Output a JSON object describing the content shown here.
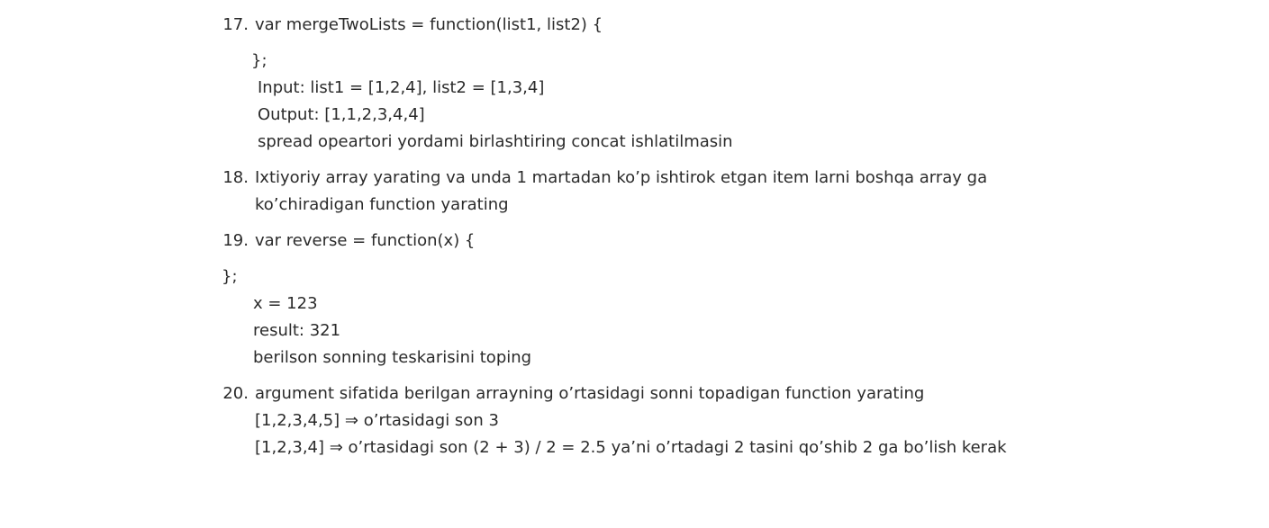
{
  "items": [
    {
      "number": "17.",
      "lines": [
        "var mergeTwoLists = function(list1, list2) {",
        "};",
        "Input: list1 = [1,2,4], list2 = [1,3,4]",
        "Output: [1,1,2,3,4,4]",
        "spread opeartori yordami birlashtiring concat ishlatilmasin"
      ]
    },
    {
      "number": "18.",
      "lines": [
        "Ixtiyoriy array yarating va unda 1 martadan ko’p ishtirok etgan item larni boshqa array ga",
        "ko’chiradigan function yarating"
      ]
    },
    {
      "number": "19.",
      "lines": [
        "var reverse = function(x) {",
        "};",
        "x = 123",
        "result: 321",
        "berilson sonning teskarisini toping"
      ]
    },
    {
      "number": "20.",
      "lines": [
        "argument sifatida berilgan arrayning o’rtasidagi sonni topadigan function yarating",
        "[1,2,3,4,5] ⇒ o’rtasidagi son 3",
        "[1,2,3,4] ⇒ o’rtasidagi son (2 + 3) / 2 = 2.5 ya’ni o’rtadagi 2 tasini qo’shib 2 ga bo’lish kerak"
      ]
    }
  ]
}
